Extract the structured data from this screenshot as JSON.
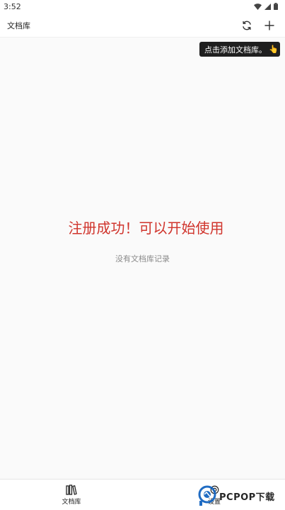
{
  "status_bar": {
    "time": "3:52"
  },
  "app_bar": {
    "title": "文档库",
    "refresh_icon": "refresh-icon",
    "add_icon": "plus-icon"
  },
  "tooltip": {
    "text": "点击添加文档库。",
    "hand_icon": "pointing-hand-icon",
    "hand": "👆"
  },
  "main": {
    "success_message": "注册成功！可以开始使用",
    "empty_message": "没有文档库记录",
    "success_color": "#d0342c"
  },
  "bottom_nav": {
    "tabs": [
      {
        "label": "文档库",
        "icon": "library-books-icon"
      },
      {
        "label": "设置",
        "icon": "settings-icon"
      }
    ]
  },
  "watermark": {
    "text": "PCPOP下载"
  }
}
